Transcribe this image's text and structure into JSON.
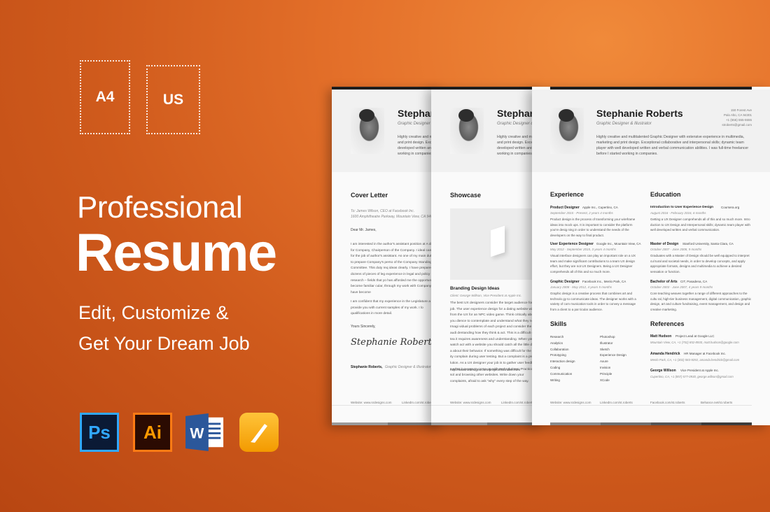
{
  "sizes": {
    "a4": "A4",
    "us": "US"
  },
  "headline": {
    "line1": "Professional",
    "line2": "Resume"
  },
  "tagline": {
    "line1": "Edit, Customize &",
    "line2": "Get Your Dream Job"
  },
  "apps": {
    "ps": "Ps",
    "ai": "Ai",
    "word": "W"
  },
  "resume": {
    "name": "Stephanie Roberts",
    "name_short": "Stephani",
    "role": "Graphic Designer & Illustrator",
    "contact": [
      "150 Forest Ave",
      "Palo Alto, CA 94301",
      "+1 (555) 555-5555",
      "stroberts@gmail.com"
    ],
    "intro": "Highly creative and multitalented Graphic Designer with extensive experience in multimedia, marketing and print design. Exceptional collaborative and interpersonal skills; dynamic team player with well developed written and verbal communication abilities. I was full-time freelancer before I started working in companies.",
    "intro_short": "Highly creative and mu and print design. Exce developed written and working in companies.",
    "cover_letter": {
      "heading": "Cover Letter",
      "to": "To: James Wilson, CEO at Facebook Inc.",
      "address": "1600 Amphitheatre Parkway, Mountain View, CA 94043",
      "greeting": "Dear Mr. James,",
      "p1": "I am interested in the author's assistant position at A director for Company, Chairperson of the Company. I ideal candidate for the job of author's assistant. As one of my main duties is to prepare Company's perso of the Company Standing Committee. This duty req ideas clearly. I have prepared dozens of pieces of leg experience in legal and policy research – fields that yo has afforded me the opportunity to become familiar cular, through my work with Company, I have become",
      "p2": "I am confident that my experience in the Legislature a can provide you with current samples of my work. I lo qualifications in more detail.",
      "closing": "Yours Sincerely,",
      "signature": "Stephanie Roberts",
      "sign_name": "Stephanie Roberts,",
      "sign_role": "Graphic Designer & Illustrator"
    },
    "showcase": {
      "heading": "Showcase",
      "project": "Branding Design Ideas",
      "client": "Client: George Willson, Vice President at Apple Inc.",
      "body": "The best UX designers consider the target audience for a job. The user experience design for a dating website will be from the UX for an NPC video game. Think critically about you dience to contemplate and understand what they need. Imagi vidual problems of each project and consider the target audi dentanding how they think & act. This is a difficult skill to tea it requires awareness and understanding. When you watch act with a website you should catch all the little details a about their behavior. If something was difficult for the user t ity complain during user testing. But a complaint is a proble lution. As a UX designer your job is to gather user feedback a what it means to come up with real solutions. Practice by sol and browsing other websites. Write down your complaints, afraid to ask \"why\" every step of the way.",
      "link": "http://www.srdesigns.com/project/01/index.html"
    },
    "experience": {
      "heading": "Experience",
      "jobs": [
        {
          "title": "Product Designer",
          "company": "Apple Inc., Cupertino, CA",
          "dates": "September 2015 - Present, 2 years 4 months",
          "desc": "Product design is the process of transforming your wireframe ideas into mock ups. It is important to consider the platform you're desig ning in order to understand the needs of the developers on the way to final product."
        },
        {
          "title": "User Experience Designer",
          "company": "Google Inc., Mountain View, CA",
          "dates": "May 2012 - September 2015, 3 years 4 months",
          "desc": "Visual interface designers can play an important role on a UX team and make significant contributions to a team UX design effort, but they are not UX Designers. Being a UX Designer comprehends all of this and so much more."
        },
        {
          "title": "Graphic Designer",
          "company": "Facebook Inc., Menlo Park, CA",
          "dates": "January 2008 - May 2012, 4 years 5 months",
          "desc": "Graphic design is a creative process that combines art and technolo gy to communicate ideas. The designer works with a variety of com munication tools in order to convey a message from a client to a par ticular audience."
        }
      ]
    },
    "education": {
      "heading": "Education",
      "items": [
        {
          "title": "Introduction to User Experience Design",
          "school": "Coursera.org",
          "dates": "August 2016 - February 2016, 6 months",
          "desc": "Getting a UX Designer comprehends all of this and so much more. Intro duction to UX Design and Interpersonal skills; dynamic team player with well developed written and verbal communication."
        },
        {
          "title": "Master of Design",
          "school": "Stanford University, Santa Clara, CA",
          "dates": "October 2007 - June 2008, 9 months",
          "desc": "Graduates with a Master of Design should be well equipped to interpret cul tural and societal needs, in order to develop concepts, and apply appropriate formats, designs and multimedia to achieve a desired sensation or function."
        },
        {
          "title": "Bachelor of Arts",
          "school": "CIT, Pasadena, CA",
          "dates": "October 2003 - June 2007, 4 years 9 months",
          "desc": "Core teaching weaves together a range of different approaches to the cultu ral, high-tier business management, digital communication, graphic design, art and culture fundraising, event management, and design and creative marketing."
        }
      ]
    },
    "skills": {
      "heading": "Skills",
      "col1": [
        "Research",
        "Analytics",
        "Collaboration",
        "Prototyping",
        "Interaction design",
        "Coding",
        "Communication",
        "Writing"
      ],
      "col2": [
        "Photoshop",
        "Illustrator",
        "Sketch",
        "Experience Design",
        "Axure",
        "Invision",
        "Principle",
        "XCode"
      ]
    },
    "references": {
      "heading": "References",
      "items": [
        {
          "name": "Matt Hudson",
          "role": "Project Lead at Google LLC",
          "info": "Mountain View, CA, +1 (752) 852-8930, matt.hudson@google.com"
        },
        {
          "name": "Amanda Hendrick",
          "role": "HR Manager at Facebook Inc.",
          "info": "Menlo Park, CA, +1 (302) 583-9292, amanda.hendrick@gmail.com"
        },
        {
          "name": "George Willson",
          "role": "Vice President at Apple Inc.",
          "info": "Cupertino, CA, +1 (857) 577-0930, george.willson@gmail.com"
        }
      ]
    },
    "footer": {
      "website": "Website: www.srdesigns.com",
      "linkedin": "LinkedIn.com/st.roberts",
      "facebook": "Facebook.com/st.roberts",
      "behance": "Behance.net/st.roberts"
    },
    "colors": [
      "#8a8a8a",
      "#6f6f6f",
      "#555555",
      "#3c3c3c"
    ]
  }
}
